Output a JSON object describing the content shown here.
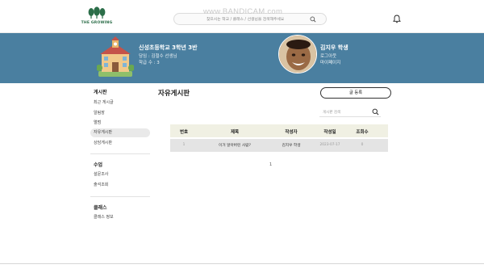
{
  "brand": {
    "logo_text": "THE GROWING"
  },
  "search": {
    "placeholder": "찾으시는 학교 / 클래스 / 선생님을 검색해주세요"
  },
  "watermark": "www.BANDICAM.com",
  "banner": {
    "school_name": "신성초등학교 3학년 3반",
    "teacher_line": "담임 : 김철수 선생님",
    "count_line": "학급 수 : 3",
    "student_name": "김지우 학생",
    "logout_label": "로그아웃",
    "mypage_label": "마이페이지"
  },
  "sidebar": {
    "sections": [
      {
        "title": "게시판",
        "items": [
          "최근 게시글",
          "알림장",
          "앨범",
          "자유게시판",
          "상담게시판"
        ]
      },
      {
        "title": "수업",
        "items": [
          "설문조사",
          "출석조회"
        ]
      },
      {
        "title": "클래스",
        "items": [
          "클래스 정보"
        ]
      }
    ],
    "active_item": "자유게시판"
  },
  "board": {
    "title": "자유게시판",
    "write_label": "글 등록",
    "search_placeholder": "게시판 검색",
    "columns": [
      "번호",
      "제목",
      "작성자",
      "작성일",
      "조회수"
    ],
    "rows": [
      {
        "no": "1",
        "title": "이거 알아버린 사람?",
        "author": "김지우 학생",
        "date": "2023-07-17",
        "views": "0"
      }
    ],
    "page": "1"
  },
  "colors": {
    "banner": "#4a7fa0",
    "brand_green": "#2c6e49",
    "table_header": "#f0f0e3",
    "active_item": "#e9e9e9"
  }
}
